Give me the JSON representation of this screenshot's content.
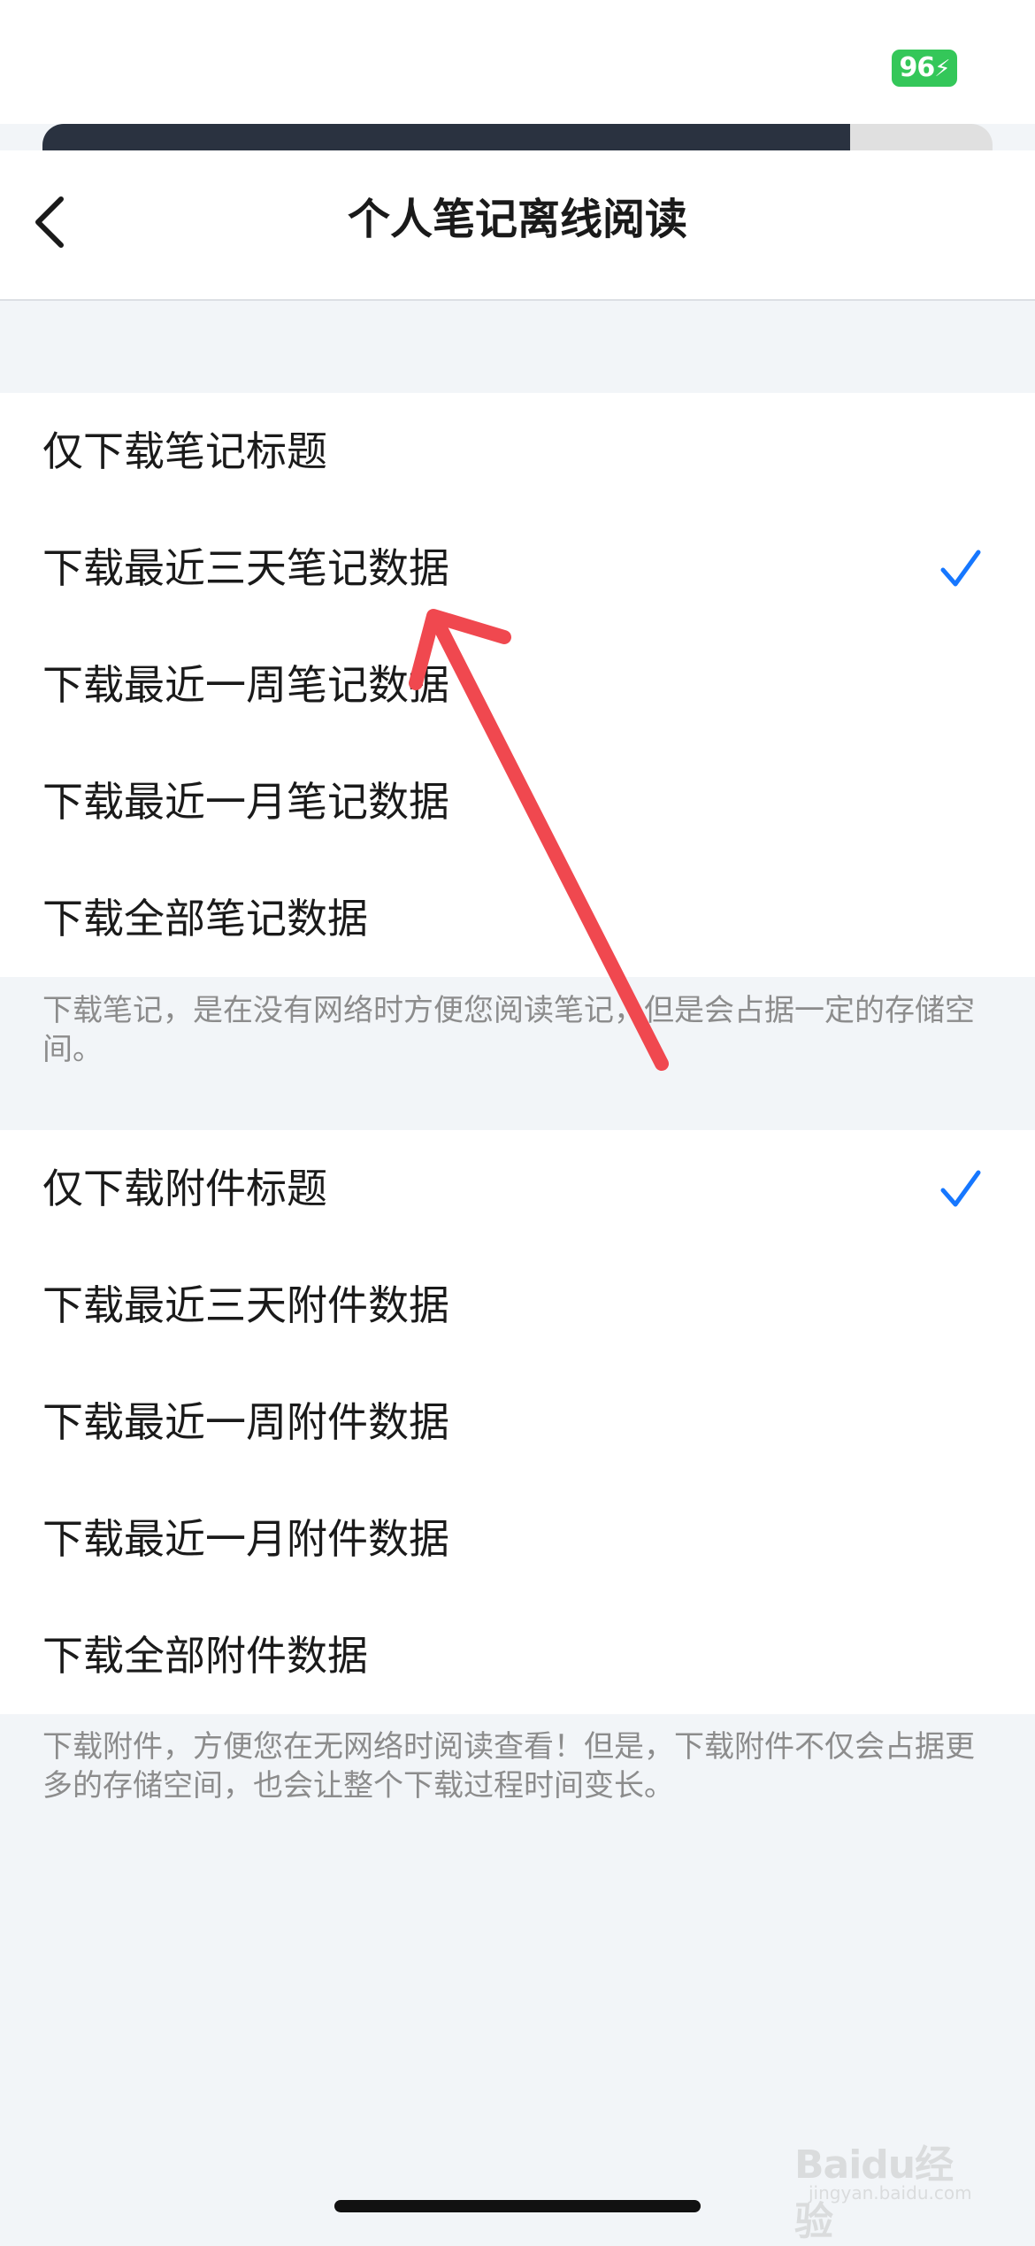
{
  "status": {
    "battery": "96"
  },
  "progress": {
    "value": 0.85
  },
  "header": {
    "title": "个人笔记离线阅读",
    "back_icon": "chevron-left-icon"
  },
  "notes_section": {
    "options": [
      {
        "label": "仅下载笔记标题",
        "checked": false
      },
      {
        "label": "下载最近三天笔记数据",
        "checked": true
      },
      {
        "label": "下载最近一周笔记数据",
        "checked": false
      },
      {
        "label": "下载最近一月笔记数据",
        "checked": false
      },
      {
        "label": "下载全部笔记数据",
        "checked": false
      }
    ],
    "footnote": "下载笔记，是在没有网络时方便您阅读笔记，但是会占据一定的存储空间。"
  },
  "attachments_section": {
    "options": [
      {
        "label": "仅下载附件标题",
        "checked": true
      },
      {
        "label": "下载最近三天附件数据",
        "checked": false
      },
      {
        "label": "下载最近一周附件数据",
        "checked": false
      },
      {
        "label": "下载最近一月附件数据",
        "checked": false
      },
      {
        "label": "下载全部附件数据",
        "checked": false
      }
    ],
    "footnote": "下载附件，方便您在无网络时阅读查看！但是，下载附件不仅会占据更多的存储空间，也会让整个下载过程时间变长。"
  },
  "watermark": {
    "text": "Baidu经验",
    "sub": "jingyan.baidu.com"
  },
  "colors": {
    "accent": "#1677ff",
    "annotation": "#f0484f",
    "background": "#f2f5f8"
  }
}
